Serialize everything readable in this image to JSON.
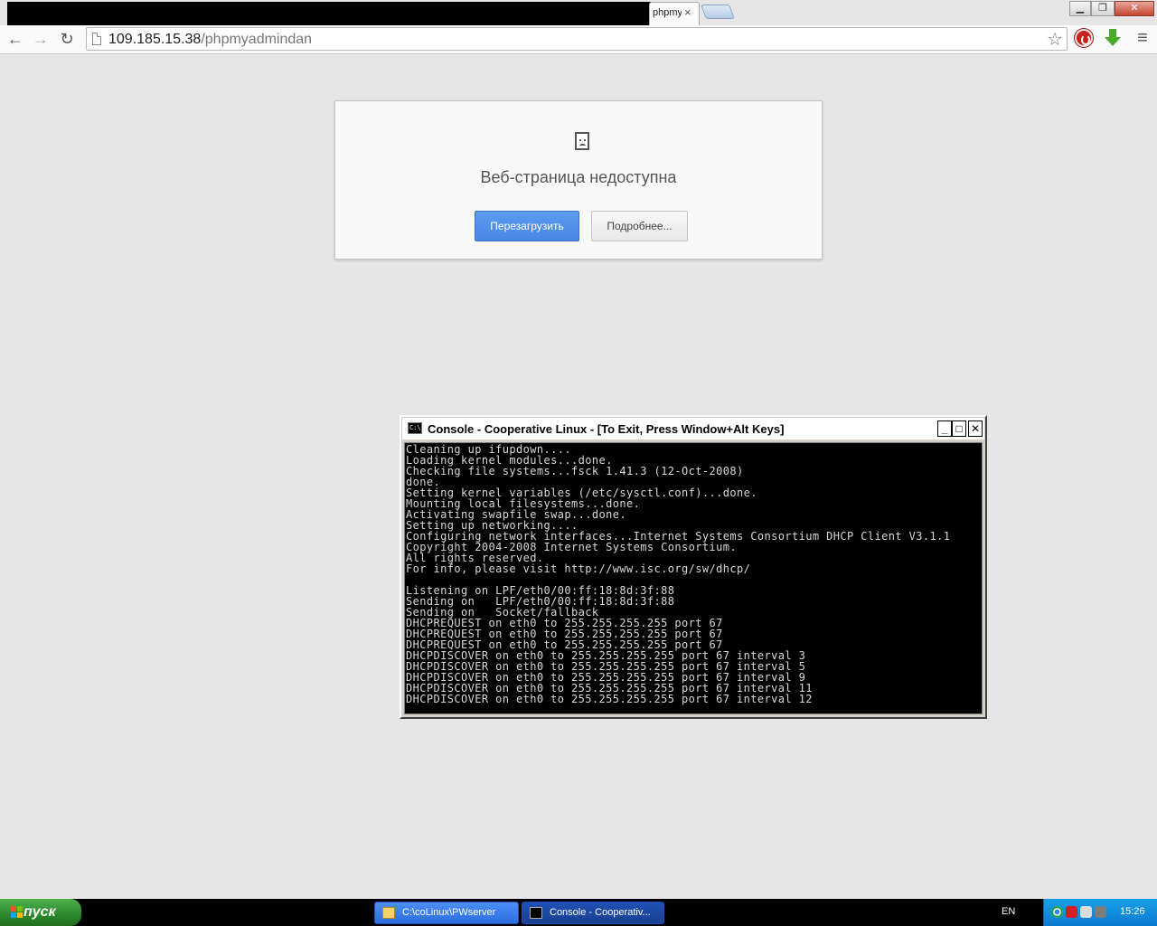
{
  "browser": {
    "tab_title": "phpmyadmindan",
    "tab_close": "×",
    "url_host": "109.185.15.38",
    "url_path": "/phpmyadmindan",
    "window_controls": {
      "minimize": "▁",
      "maximize": "❐",
      "close": "✕"
    },
    "nav_icons": {
      "back": "←",
      "forward": "→",
      "reload": "↻",
      "star": "☆",
      "menu": "≡"
    }
  },
  "error_page": {
    "title": "Веб-страница недоступна",
    "reload_button": "Перезагрузить",
    "details_button": "Подробнее..."
  },
  "console": {
    "title": "Console - Cooperative Linux - [To Exit, Press Window+Alt Keys]",
    "icon_text": "C:\\",
    "buttons": {
      "minimize": "_",
      "maximize": "□",
      "close": "✕"
    },
    "lines": [
      "Cleaning up ifupdown....",
      "Loading kernel modules...done.",
      "Checking file systems...fsck 1.41.3 (12-Oct-2008)",
      "done.",
      "Setting kernel variables (/etc/sysctl.conf)...done.",
      "Mounting local filesystems...done.",
      "Activating swapfile swap...done.",
      "Setting up networking....",
      "Configuring network interfaces...Internet Systems Consortium DHCP Client V3.1.1",
      "Copyright 2004-2008 Internet Systems Consortium.",
      "All rights reserved.",
      "For info, please visit http://www.isc.org/sw/dhcp/",
      "",
      "Listening on LPF/eth0/00:ff:18:8d:3f:88",
      "Sending on   LPF/eth0/00:ff:18:8d:3f:88",
      "Sending on   Socket/fallback",
      "DHCPREQUEST on eth0 to 255.255.255.255 port 67",
      "DHCPREQUEST on eth0 to 255.255.255.255 port 67",
      "DHCPREQUEST on eth0 to 255.255.255.255 port 67",
      "DHCPDISCOVER on eth0 to 255.255.255.255 port 67 interval 3",
      "DHCPDISCOVER on eth0 to 255.255.255.255 port 67 interval 5",
      "DHCPDISCOVER on eth0 to 255.255.255.255 port 67 interval 9",
      "DHCPDISCOVER on eth0 to 255.255.255.255 port 67 interval 11",
      "DHCPDISCOVER on eth0 to 255.255.255.255 port 67 interval 12"
    ]
  },
  "taskbar": {
    "start_label": "пуск",
    "tasks": [
      {
        "label": "C:\\coLinux\\PWserver"
      },
      {
        "label": "Console - Cooperativ..."
      }
    ],
    "language": "EN",
    "clock": "15:26"
  },
  "colors": {
    "page_bg": "#e6e6e6",
    "primary_button": "#4d8ee8",
    "console_bg": "#000000",
    "console_text": "#d8d8d8",
    "taskbar_start": "#2d8a2d",
    "tray": "#0c7ad2"
  },
  "icons": {
    "page": "page-icon",
    "sad_page": "sad-page-icon",
    "star": "star-icon",
    "extension": "ext-stop-icon",
    "download": "download-icon",
    "menu": "menu-icon"
  }
}
